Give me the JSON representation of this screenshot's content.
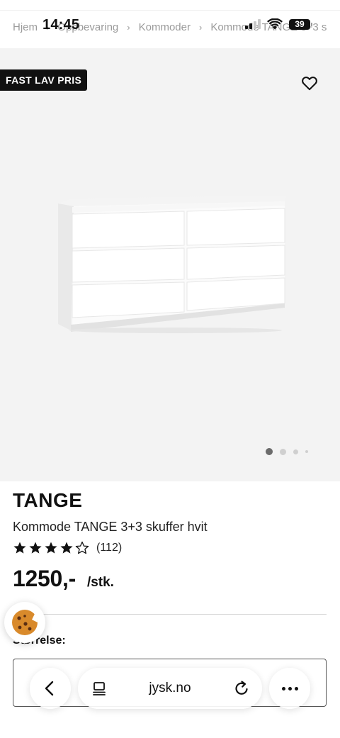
{
  "status_bar": {
    "time": "14:45",
    "battery": "39"
  },
  "breadcrumb": [
    "Hjem",
    "Oppbevaring",
    "Kommoder",
    "Kommode TANGE 3+3 s"
  ],
  "gallery": {
    "badge": "FAST LAV PRIS",
    "current_image": 1,
    "image_count": 4
  },
  "product": {
    "name": "TANGE",
    "subtitle": "Kommode TANGE 3+3 skuffer hvit",
    "rating": 4,
    "rating_max": 5,
    "review_count": "(112)",
    "price": "1250,-",
    "unit": "/stk.",
    "size_label": "Størrelse:"
  },
  "browser": {
    "domain": "jysk.no"
  },
  "icons": [
    "heart-icon",
    "star-icon",
    "cookie-icon",
    "chevron-left-icon",
    "tabs-icon",
    "reload-icon",
    "more-icon",
    "wifi-icon",
    "signal-icon",
    "battery-icon"
  ]
}
